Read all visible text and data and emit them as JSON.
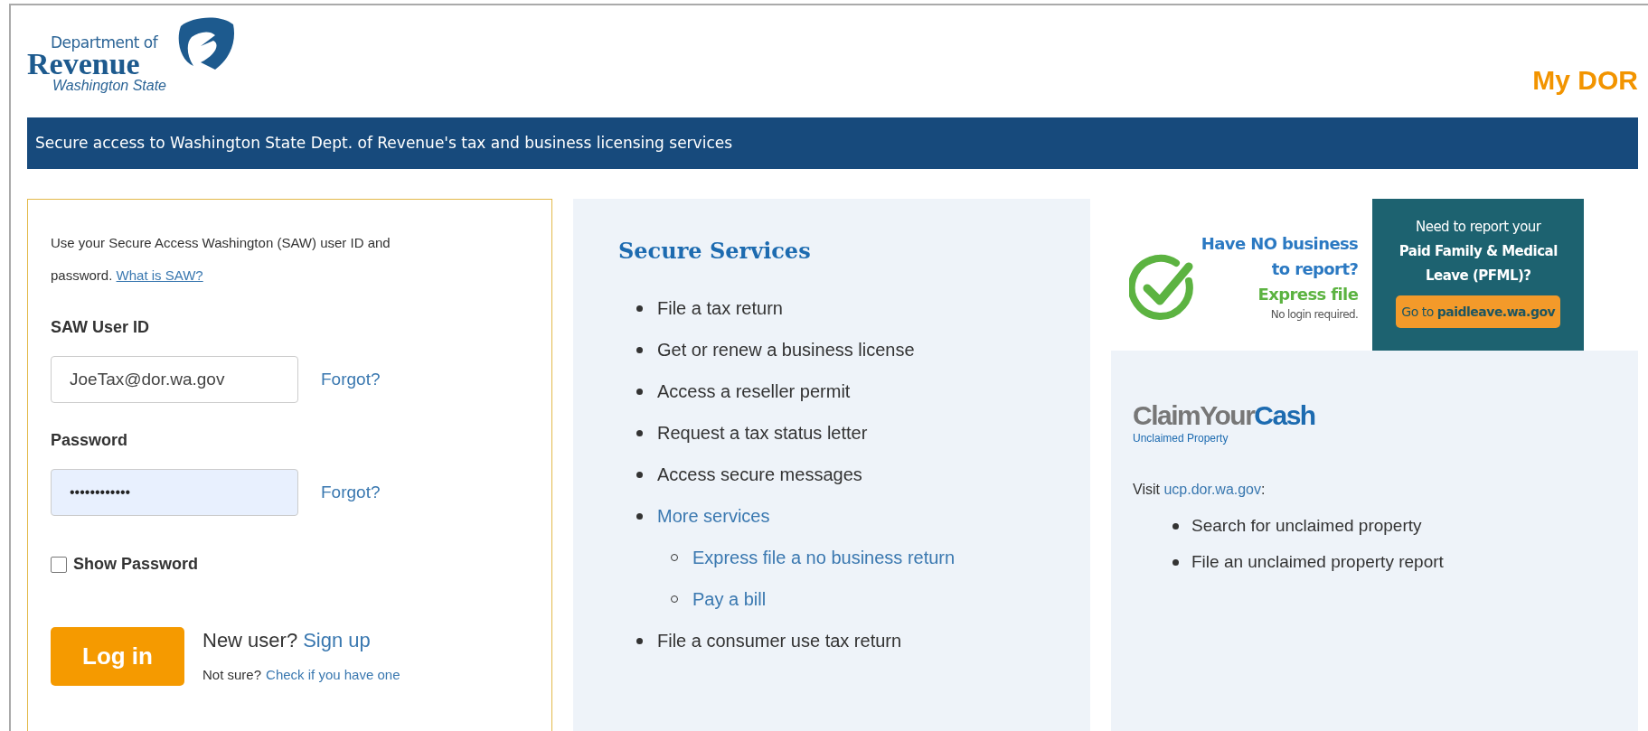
{
  "header": {
    "logo": {
      "line_1": "Department of",
      "line_2": "Revenue",
      "line_3": "Washington State"
    },
    "title": "My DOR"
  },
  "banner": "Secure access to Washington State Dept. of Revenue's tax and business licensing services",
  "login": {
    "intro": "Use your Secure Access Washington (SAW) user ID and password.",
    "intro_link": "What is SAW?",
    "user_id": {
      "label": "SAW User ID",
      "value": "JoeTax@dor.wa.gov",
      "forgot": "Forgot?"
    },
    "password": {
      "label": "Password",
      "value": "••••••••••••",
      "forgot": "Forgot?"
    },
    "show_password": {
      "label": "Show Password",
      "checked": false
    },
    "button": "Log in",
    "new_user": "New user?",
    "sign_up": "Sign up",
    "not_sure": "Not sure?",
    "check_link": "Check if you have one"
  },
  "services": {
    "title": "Secure Services",
    "items": [
      {
        "label": "File a tax return",
        "kind": "text"
      },
      {
        "label": "Get or renew a business license",
        "kind": "text"
      },
      {
        "label": "Access a reseller permit",
        "kind": "text"
      },
      {
        "label": "Request a tax status letter",
        "kind": "text"
      },
      {
        "label": "Access secure messages",
        "kind": "text"
      },
      {
        "label": "More services",
        "kind": "link",
        "children": [
          {
            "label": "Express file a no business return",
            "kind": "link"
          },
          {
            "label": "Pay a bill",
            "kind": "link"
          }
        ]
      },
      {
        "label": "File a consumer use tax return",
        "kind": "text"
      }
    ]
  },
  "express_promo": {
    "line_1": "Have NO business",
    "line_2": "to report?",
    "line_3": "Express file",
    "note": "No login required."
  },
  "pfml_promo": {
    "line_1": "Need to report your",
    "line_2": "Paid Family & Medical",
    "line_3": "Leave (PFML)?",
    "button": "Go to **paidleave.wa.gov**"
  },
  "unclaimed": {
    "logo_first": "ClaimYour",
    "logo_second": "Cash",
    "subtitle": "Unclaimed Property",
    "visit": "Visit",
    "link": "ucp.dor.wa.gov",
    "colon": ":",
    "items": [
      "Search for unclaimed property",
      "File an unclaimed property report"
    ]
  }
}
